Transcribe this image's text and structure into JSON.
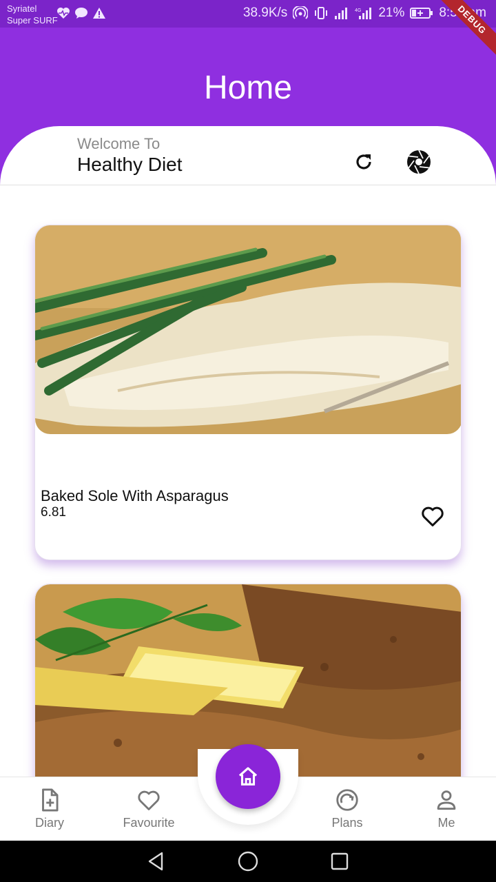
{
  "status_bar": {
    "carrier_line1": "Syriatel",
    "carrier_line2": "Super SURF",
    "net_speed": "38.9K/s",
    "battery": "21%",
    "time": "8:59 am",
    "debug_label": "DEBUG",
    "left_icons": [
      "health-icon",
      "message-icon",
      "warning-icon"
    ],
    "right_icons": [
      "hotspot-icon",
      "vibrate-icon",
      "signal-icon",
      "signal-4g-icon",
      "battery-icon"
    ]
  },
  "app_bar": {
    "title": "Home",
    "welcome_small": "Welcome To",
    "welcome_big": "Healthy Diet",
    "actions": [
      "refresh-icon",
      "camera-aperture-icon"
    ],
    "background_color": "#8f2fe0"
  },
  "foods": [
    {
      "name": "Baked Sole With Asparagus",
      "price": "6.81",
      "favorite": false
    },
    {
      "name": "",
      "price": "",
      "favorite": false
    }
  ],
  "bottom_nav": {
    "items": [
      {
        "label": "Diary",
        "icon": "diary-add-icon"
      },
      {
        "label": "Favourite",
        "icon": "heart-icon"
      },
      {
        "label": "Plans",
        "icon": "plans-gauge-icon"
      },
      {
        "label": "Me",
        "icon": "person-icon"
      }
    ],
    "fab_icon": "home-icon",
    "fab_color": "#8a25d8"
  },
  "system_nav": [
    "back-icon",
    "home-circle-icon",
    "recents-icon"
  ]
}
